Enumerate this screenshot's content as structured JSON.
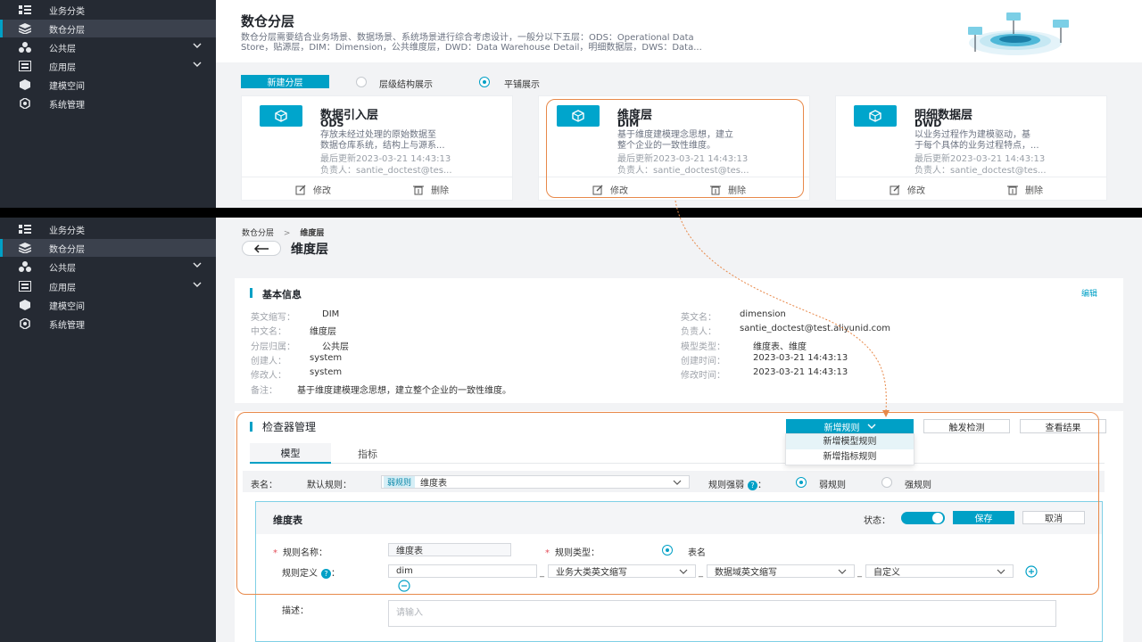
{
  "sidebar": {
    "items": [
      {
        "label": "业务分类",
        "icon": "grid-icon"
      },
      {
        "label": "数仓分层",
        "icon": "layers-icon",
        "active": true
      },
      {
        "label": "公共层",
        "icon": "cubes-icon",
        "expandable": true
      },
      {
        "label": "应用层",
        "icon": "window-icon",
        "expandable": true
      },
      {
        "label": "建模空间",
        "icon": "cube-icon"
      },
      {
        "label": "系统管理",
        "icon": "gear-icon"
      }
    ]
  },
  "top": {
    "title": "数仓分层",
    "description_line1": "数仓分层需要结合业务场景、数据场景、系统场景进行综合考虑设计，一般分以下五层：ODS：Operational Data",
    "description_line2": "Store，贴源层，DIM：Dimension，公共维度层，DWD：Data Warehouse Detail，明细数据层，DWS：Data...",
    "new_layer_button": "新建分层",
    "view_hierarchy": "层级结构展示",
    "view_tile": "平铺展示",
    "cards": [
      {
        "title": "数据引入层",
        "code": "ODS",
        "desc1": "存放未经过处理的原始数据至",
        "desc2": "数据仓库系统，结构上与源系...",
        "updated": "最后更新2023-03-21 14:43:13",
        "owner": "负责人：santie_doctest@tes...",
        "edit": "修改",
        "delete": "删除"
      },
      {
        "title": "维度层",
        "code": "DIM",
        "desc1": "基于维度建模理念思想，建立",
        "desc2": "整个企业的一致性维度。",
        "updated": "最后更新2023-03-21 14:43:13",
        "owner": "负责人：santie_doctest@tes...",
        "edit": "修改",
        "delete": "删除"
      },
      {
        "title": "明细数据层",
        "code": "DWD",
        "desc1": "以业务过程作为建模驱动，基",
        "desc2": "于每个具体的业务过程特点，...",
        "updated": "最后更新2023-03-21 14:43:13",
        "owner": "负责人：santie_doctest@tes...",
        "edit": "修改",
        "delete": "删除"
      }
    ]
  },
  "detail": {
    "breadcrumb_root": "数仓分层",
    "breadcrumb_sep": ">",
    "breadcrumb_current": "维度层",
    "page_title": "维度层",
    "basic_title": "基本信息",
    "edit_link": "编辑",
    "fields_left": [
      {
        "label": "英文缩写：",
        "value": "DIM"
      },
      {
        "label": "中文名：",
        "value": "维度层"
      },
      {
        "label": "分层归属：",
        "value": "公共层"
      },
      {
        "label": "创建人：",
        "value": "system"
      },
      {
        "label": "修改人：",
        "value": "system"
      }
    ],
    "fields_right": [
      {
        "label": "英文名：",
        "value": "dimension"
      },
      {
        "label": "负责人：",
        "value": "santie_doctest@test.aliyunid.com"
      },
      {
        "label": "模型类型：",
        "value": "维度表、维度"
      },
      {
        "label": "创建时间：",
        "value": "2023-03-21 14:43:13"
      },
      {
        "label": "修改时间：",
        "value": "2023-03-21 14:43:13"
      }
    ],
    "remark_label": "备注：",
    "remark_value": "基于维度建模理念思想，建立整个企业的一致性维度。"
  },
  "checker": {
    "title": "检查器管理",
    "new_rule_button": "新增规则",
    "trigger_button": "触发检测",
    "view_result_button": "查看结果",
    "dropdown": [
      "新增模型规则",
      "新增指标规则"
    ],
    "tabs": [
      "模型",
      "指标"
    ],
    "table_name_label": "表名：",
    "default_rule_label": "默认规则：",
    "weak_tag": "弱规则",
    "default_rule_value": "维度表",
    "strength_label": "规则强弱",
    "weak_option": "弱规则",
    "strong_option": "强规则"
  },
  "rule_form": {
    "title": "维度表",
    "status_label": "状态：",
    "save_button": "保存",
    "cancel_button": "取消",
    "name_label": "规则名称：",
    "name_value": "维度表",
    "type_label": "规则类型：",
    "type_option": "表名",
    "def_label": "规则定义",
    "def_value": "dim",
    "def_sel1": "业务大类英文缩写",
    "def_sel2": "数据域英文缩写",
    "def_sel3": "自定义",
    "desc_label": "描述：",
    "desc_placeholder": "请输入"
  },
  "colors": {
    "accent": "#00a0c6",
    "highlight": "#e8894a",
    "sidebar": "#252a33"
  }
}
